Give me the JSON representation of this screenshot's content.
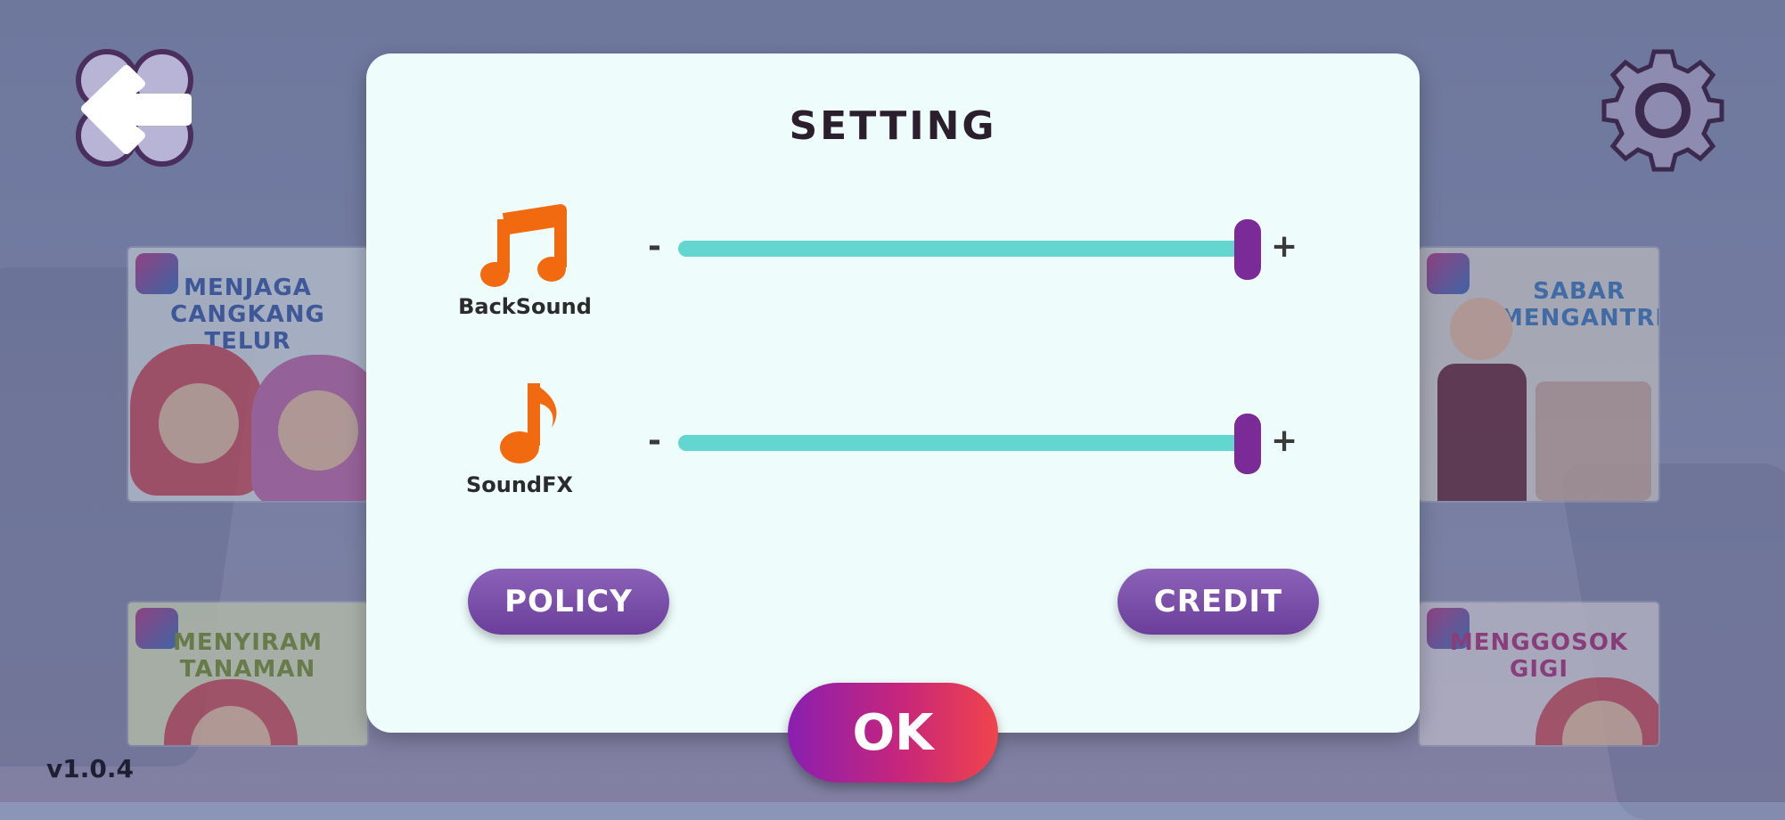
{
  "dialog": {
    "title": "SETTING",
    "rows": [
      {
        "label": "BackSound",
        "icon": "double-music-note-icon",
        "minus": "-",
        "plus": "+",
        "level": 1.0
      },
      {
        "label": "SoundFX",
        "icon": "music-note-icon",
        "minus": "-",
        "plus": "+",
        "level": 1.0
      }
    ],
    "policy_label": "POLICY",
    "credit_label": "CREDIT",
    "ok_label": "OK"
  },
  "books": [
    {
      "title": "MENJAGA CANGKANG TELUR"
    },
    {
      "title": "SABAR MENGANTRE"
    },
    {
      "title": "MENYIRAM TANAMAN"
    },
    {
      "title": "MENGGOSOK GIGI"
    }
  ],
  "version": "v1.0.4",
  "colors": {
    "dialog_bg": "#eefcfb",
    "slider_track": "#63d6d0",
    "slider_thumb": "#7b2b98",
    "pill_button": "#7a4dab",
    "ok_gradient_start": "#8a1fb0",
    "ok_gradient_end": "#f0444c",
    "icon_orange": "#f26a10"
  }
}
